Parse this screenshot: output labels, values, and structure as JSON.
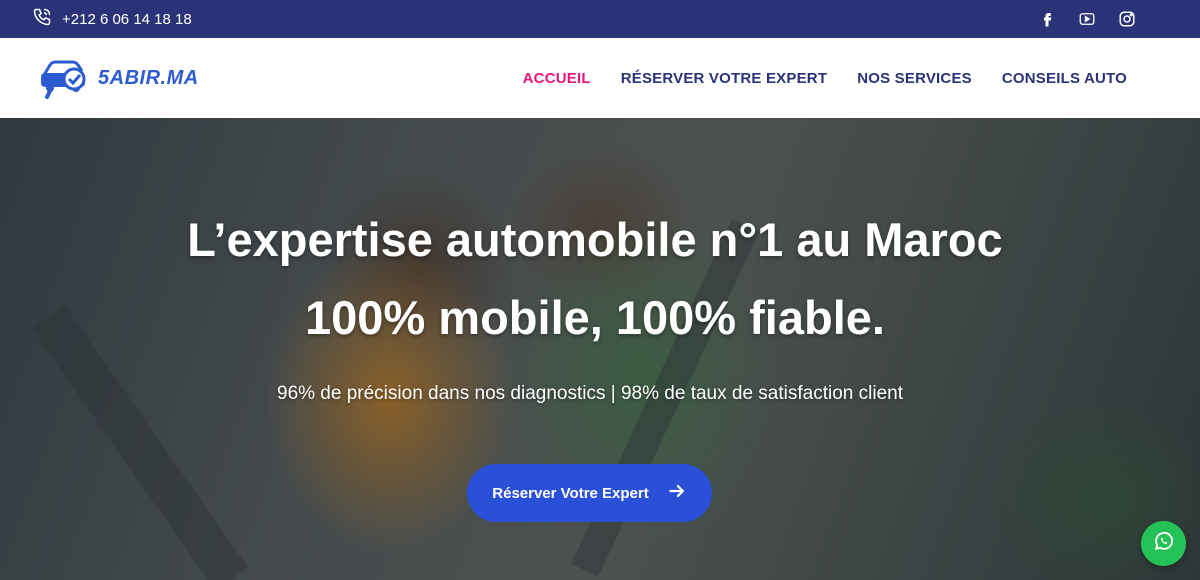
{
  "topbar": {
    "phone": "+212 6 06 14 18 18",
    "icons": [
      "phone-icon",
      "facebook-icon",
      "youtube-icon",
      "instagram-icon"
    ]
  },
  "header": {
    "logo_text": "5ABIR.MA",
    "nav": [
      {
        "label": "ACCUEIL",
        "active": true
      },
      {
        "label": "RÉSERVER VOTRE EXPERT",
        "active": false
      },
      {
        "label": "NOS SERVICES",
        "active": false
      },
      {
        "label": "CONSEILS AUTO",
        "active": false
      }
    ]
  },
  "hero": {
    "title_line1": "L’expertise automobile n°1 au Maroc",
    "title_line2": "100% mobile, 100% fiable.",
    "subtitle": "96% de précision dans nos diagnostics | 98% de taux de satisfaction client",
    "cta_label": "Réserver Votre Expert"
  },
  "colors": {
    "topbar_bg": "#2a3377",
    "nav_text": "#2a3377",
    "nav_active": "#e8157d",
    "logo": "#2d5bd0",
    "cta_bg": "#2b50d8",
    "whatsapp": "#25c258"
  }
}
